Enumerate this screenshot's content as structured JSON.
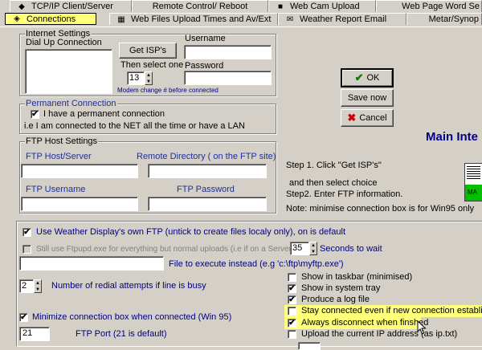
{
  "tabs": {
    "row1": [
      {
        "label": "TCP/IP Client/Server",
        "icon": "network-icon"
      },
      {
        "label": "Remote Control/ Reboot",
        "icon": ""
      },
      {
        "label": "Web Cam Upload",
        "icon": "camera-icon"
      },
      {
        "label": "Web Page Word Se",
        "icon": ""
      }
    ],
    "row2": [
      {
        "label": "Connections",
        "icon": "connections-icon",
        "active": true
      },
      {
        "label": "Web Files Upload Times and  Av/Ext",
        "icon": "calendar-icon"
      },
      {
        "label": "Weather Report Email",
        "icon": "email-icon"
      },
      {
        "label": "Metar/Synop",
        "icon": ""
      }
    ]
  },
  "internet_settings": {
    "title": "Internet Settings",
    "dial_up_label": "Dial Up Connection",
    "get_isps_label": "Get ISP's",
    "then_select_label": "Then select one",
    "modem_value": "13",
    "modem_note": "Modem change # before connected",
    "username_label": "Username",
    "username_value": "",
    "password_label": "Password",
    "password_value": ""
  },
  "permanent": {
    "title": "Permanent Connection",
    "checkbox_label": "I have a permanent connection",
    "checked": true,
    "note": "i.e I am connected to the NET all the time or have a LAN"
  },
  "ftp": {
    "title": "FTP Host Settings",
    "host_label": "FTP Host/Server",
    "remote_dir_label": "Remote Directory ( on the FTP site)",
    "username_label": "FTP Username",
    "password_label": "FTP Password"
  },
  "buttons": {
    "ok": "OK",
    "save_now": "Save now",
    "cancel": "Cancel"
  },
  "right_panel": {
    "main_title": "Main Inte",
    "step1": "Step 1. Click  \"Get ISP's\"",
    "then": "and then select choice",
    "step2": "Step2. Enter FTP information.",
    "note": "Note: minimise connection box is for Win95 only",
    "ma_label": "MA"
  },
  "lower": {
    "use_own_ftp": "Use Weather Display's own FTP  (untick to create files localy only), on is default",
    "still_use": "Still use Ftpupd.exe for everything but normal uploads (i.e if on a Server)",
    "seconds_value": "35",
    "seconds_label": "Seconds to wait",
    "file_exec_label": "File to execute instead (e.g 'c:\\ftp\\myftp.exe')",
    "redial_value": "2",
    "redial_label": "Number of redial attempts if line is busy",
    "minimize_label": "Minimize connection box when connected (Win 95)",
    "port_value": "21",
    "port_label": "FTP Port (21 is default)",
    "show_taskbar": "Show in taskbar (minimised)",
    "show_tray": "Show in system tray",
    "produce_log": "Produce a log file",
    "stay_connected": "Stay connected even if new connection established",
    "always_disconnect": "Always disconnect when finshed",
    "upload_ip": "Upload the current IP address (as ip.txt)"
  },
  "colors": {
    "highlight": "#ffff7a",
    "title_blue": "#1f2f9a",
    "ok_green": "#008000",
    "cancel_red": "#cc0000",
    "ma_green": "#00c000"
  }
}
